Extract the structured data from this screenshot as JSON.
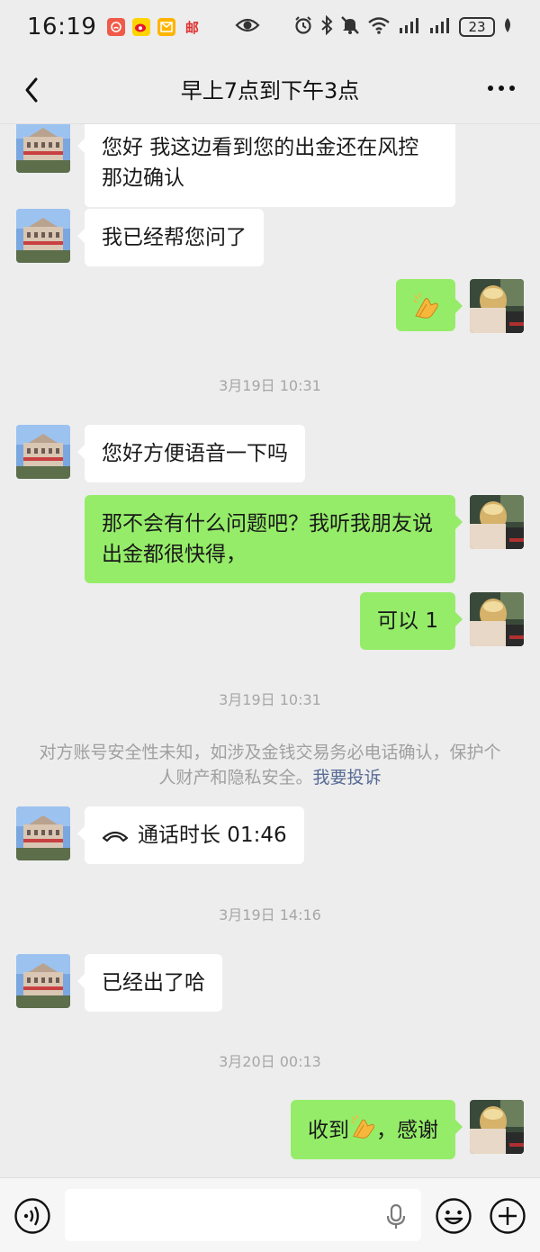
{
  "status_bar": {
    "time": "16:19",
    "app1_label": "",
    "mail_label": "",
    "post_label": "邮",
    "battery": "23"
  },
  "header": {
    "title": "早上7点到下午3点"
  },
  "messages": [
    {
      "side": "left",
      "text": "您好 我这边看到您的出金还在风控那边确认"
    },
    {
      "side": "left",
      "text": "我已经帮您问了"
    },
    {
      "side": "right",
      "emoji": "palms-together"
    },
    {
      "type": "time",
      "text": "3月19日 10:31"
    },
    {
      "side": "left",
      "text": "您好方便语音一下吗"
    },
    {
      "side": "right",
      "text": "那不会有什么问题吧？我听我朋友说出金都很快得，"
    },
    {
      "side": "right",
      "text": "可以 1"
    },
    {
      "type": "time",
      "text": "3月19日 10:31"
    },
    {
      "type": "notice",
      "text": "对方账号安全性未知，如涉及金钱交易务必电话确认，保护个人财产和隐私安全。",
      "link": "我要投诉"
    },
    {
      "side": "left",
      "call": true,
      "text": "通话时长 01:46"
    },
    {
      "type": "time",
      "text": "3月19日 14:16"
    },
    {
      "side": "left",
      "text": "已经出了哈"
    },
    {
      "type": "time",
      "text": "3月20日 00:13"
    },
    {
      "side": "right",
      "text_before": "收到",
      "emoji": "palms-together",
      "text_after": "，感谢"
    }
  ],
  "input": {
    "placeholder": ""
  },
  "colors": {
    "background": "#EDEDED",
    "bubble_right": "#95EC69",
    "bubble_left": "#FFFFFF",
    "link": "#576B95"
  }
}
